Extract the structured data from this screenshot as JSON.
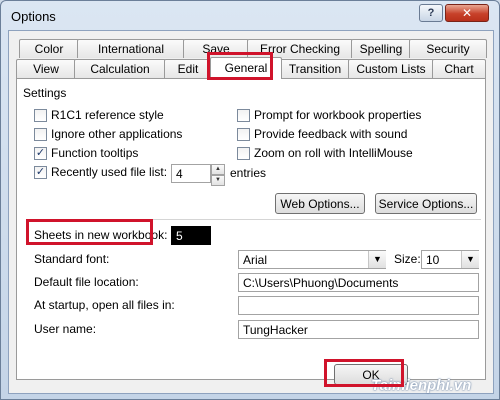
{
  "window": {
    "title": "Options",
    "help": "?",
    "close": "✕"
  },
  "tabs_row1": [
    "Color",
    "International",
    "Save",
    "Error Checking",
    "Spelling",
    "Security"
  ],
  "tabs_row2": [
    "View",
    "Calculation",
    "Edit",
    "General",
    "Transition",
    "Custom Lists",
    "Chart"
  ],
  "active_tab": "General",
  "settings": {
    "group_label": "Settings",
    "r1c1": {
      "label": "R1C1 reference style",
      "checked": false
    },
    "ignore_apps": {
      "label": "Ignore other applications",
      "checked": false
    },
    "function_tooltips": {
      "label": "Function tooltips",
      "checked": true
    },
    "recent_files": {
      "label": "Recently used file list:",
      "checked": true,
      "value": "4",
      "suffix": "entries"
    },
    "prompt_props": {
      "label": "Prompt for workbook properties",
      "checked": false
    },
    "feedback_sound": {
      "label": "Provide feedback with sound",
      "checked": false
    },
    "zoom_roll": {
      "label": "Zoom on roll with IntelliMouse",
      "checked": false
    }
  },
  "buttons": {
    "web_options": "Web Options...",
    "service_options": "Service Options...",
    "ok": "OK"
  },
  "sheets": {
    "label": "Sheets in new workbook:",
    "value": "5"
  },
  "standard_font": {
    "label": "Standard font:",
    "value": "Arial",
    "size_label": "Size:",
    "size_value": "10"
  },
  "default_location": {
    "label": "Default file location:",
    "value": "C:\\Users\\Phuong\\Documents"
  },
  "startup": {
    "label": "At startup, open all files in:",
    "value": ""
  },
  "user_name": {
    "label": "User name:",
    "value": "TungHacker"
  },
  "icons": {
    "check": "✓",
    "up": "▲",
    "down": "▼"
  },
  "watermark": "Taimienphi.vn",
  "colors": {
    "highlight": "#d0132b",
    "close_button": "#c7412a"
  }
}
